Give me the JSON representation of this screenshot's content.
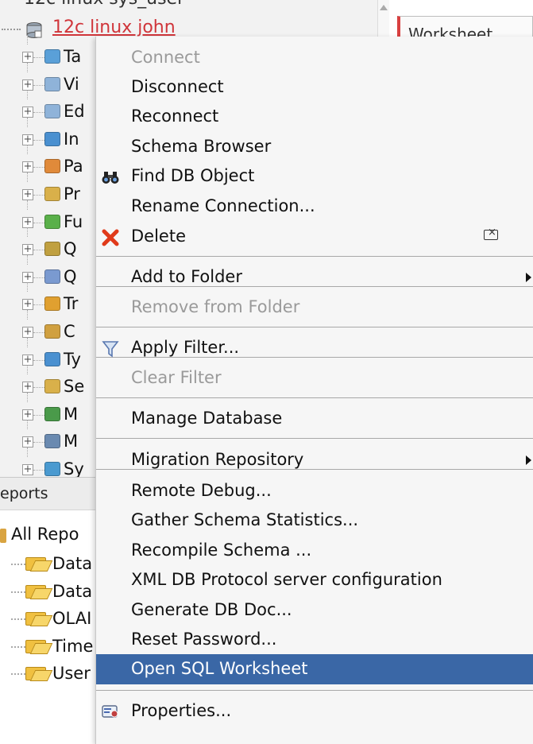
{
  "tree": {
    "top_partial": "12c linux sys_user",
    "connection_label": "12c linux john",
    "nodes": [
      "Ta",
      "Vi",
      "Ed",
      "In",
      "Pa",
      "Pr",
      "Fu",
      "Q",
      "Q",
      "Tr",
      "C",
      "Ty",
      "Se",
      "M",
      "M",
      "Sy"
    ],
    "node_colors": [
      "#5aa0d8",
      "#8fb3d9",
      "#8fb3d9",
      "#4a90d0",
      "#e08a3a",
      "#d9b04a",
      "#5ab04a",
      "#c0a040",
      "#7a9ad0",
      "#e0a030",
      "#d0a040",
      "#4a90d0",
      "#d9b04a",
      "#4a9a4a",
      "#6a8ab0",
      "#4a9ad0"
    ]
  },
  "worksheet_tab": "Worksheet",
  "reports": {
    "header": "eports",
    "root": "All Repo",
    "children": [
      "Data",
      "Data",
      "OLAI",
      "Time",
      "User"
    ]
  },
  "menu": {
    "items": [
      {
        "label": "Connect",
        "disabled": true
      },
      {
        "label": "Disconnect"
      },
      {
        "label": "Reconnect"
      },
      {
        "label": "Schema Browser"
      },
      {
        "label": "Find DB Object",
        "icon": "binoculars-icon"
      },
      {
        "label": "Rename Connection..."
      },
      {
        "label": "Delete",
        "icon": "delete-icon",
        "accel": "delete-key-icon"
      },
      {
        "label": "Add to Folder",
        "submenu": true
      },
      {
        "label": "Remove from Folder",
        "disabled": true
      },
      {
        "label": "Apply Filter...",
        "icon": "filter-icon"
      },
      {
        "label": "Clear Filter",
        "disabled": true
      },
      {
        "label": "Manage Database"
      },
      {
        "label": "Migration Repository",
        "submenu": true
      },
      {
        "label": "Remote Debug..."
      },
      {
        "label": "Gather Schema Statistics..."
      },
      {
        "label": "Recompile Schema ..."
      },
      {
        "label": "XML DB Protocol server configuration"
      },
      {
        "label": "Generate DB Doc..."
      },
      {
        "label": "Reset Password..."
      },
      {
        "label": "Open SQL Worksheet",
        "highlighted": true
      },
      {
        "label": "Properties...",
        "icon": "properties-icon"
      }
    ]
  },
  "colors": {
    "highlight": "#3a67a6",
    "connection_text": "#d0353a",
    "menu_bg": "#f6f6f6",
    "disabled_text": "#9a9a9a"
  }
}
